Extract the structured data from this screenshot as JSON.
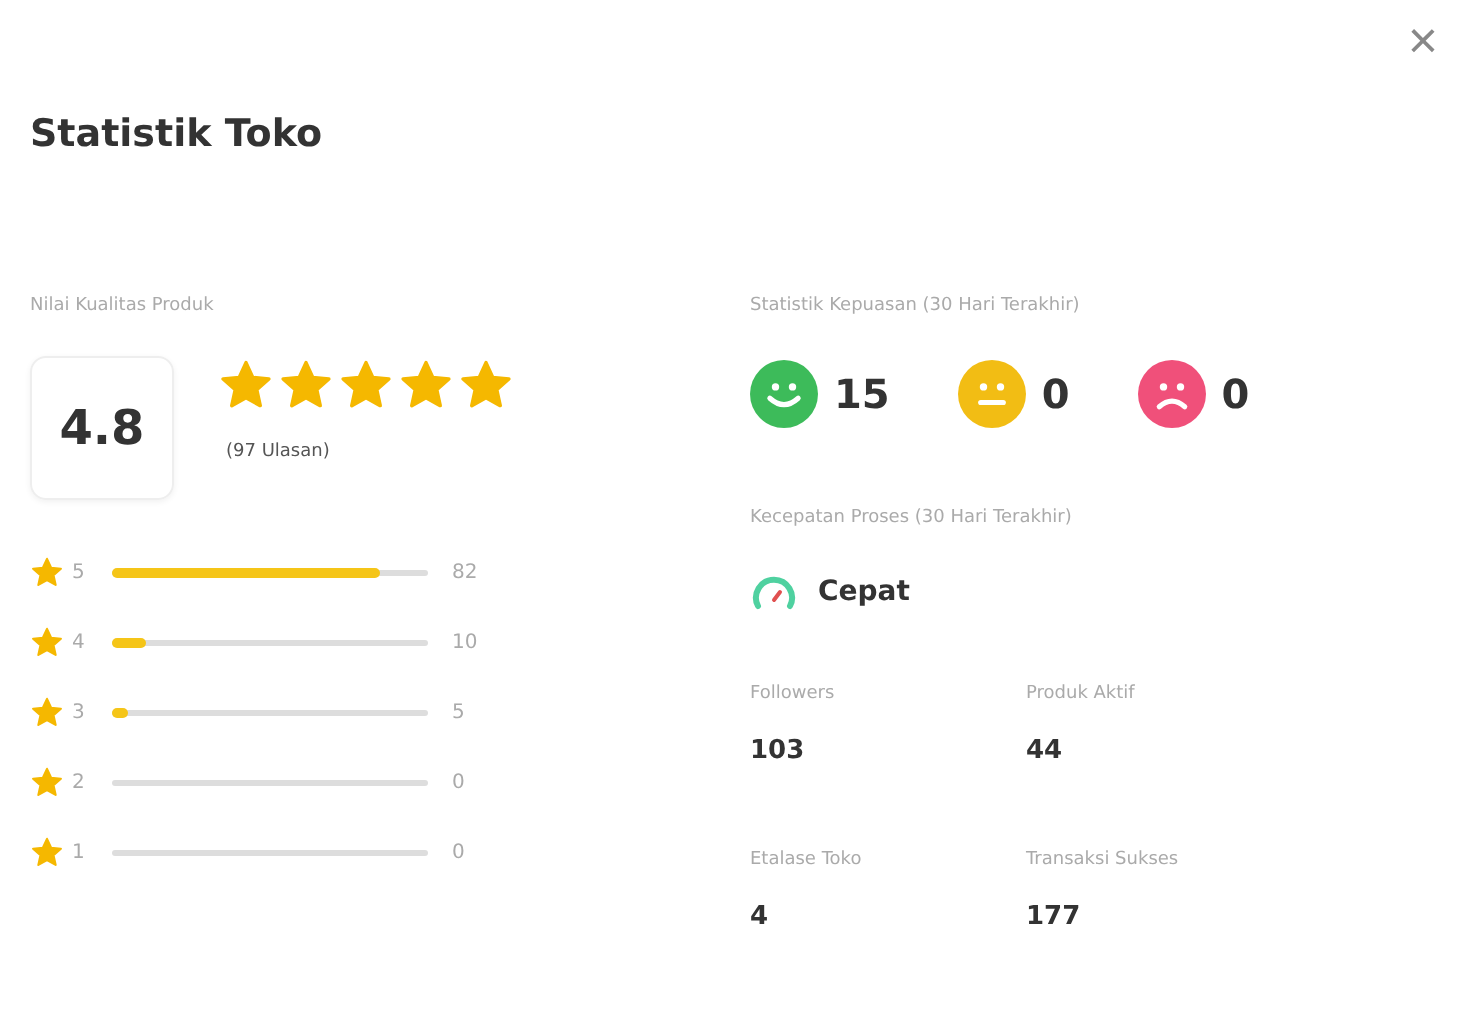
{
  "dialog": {
    "title": "Statistik Toko",
    "close": "×"
  },
  "quality": {
    "label": "Nilai Kualitas Produk",
    "score": "4.8",
    "stars": 5,
    "reviews": "(97 Ulasan)",
    "breakdown": [
      {
        "rating": "5",
        "count": "82",
        "level": 0.85
      },
      {
        "rating": "4",
        "count": "10",
        "level": 0.11
      },
      {
        "rating": "3",
        "count": "5",
        "level": 0.05
      },
      {
        "rating": "2",
        "count": "0"
      },
      {
        "rating": "1",
        "count": "0"
      }
    ]
  },
  "satisfaction": {
    "label": "Statistik Kepuasan (30 Hari Terakhir)",
    "items": [
      {
        "kind": "happy",
        "color": "#3dbb5a",
        "count": "15"
      },
      {
        "kind": "neutral",
        "color": "#f2bd14",
        "count": "0"
      },
      {
        "kind": "sad",
        "color": "#f0507a",
        "count": "0"
      }
    ]
  },
  "speed": {
    "label": "Kecepatan Proses (30 Hari Terakhir)",
    "value": "Cepat"
  },
  "stats": [
    {
      "label": "Followers",
      "value": "103"
    },
    {
      "label": "Produk Aktif",
      "value": "44"
    },
    {
      "label": "Etalase Toko",
      "value": "4"
    },
    {
      "label": "Transaksi Sukses",
      "value": "177"
    }
  ]
}
